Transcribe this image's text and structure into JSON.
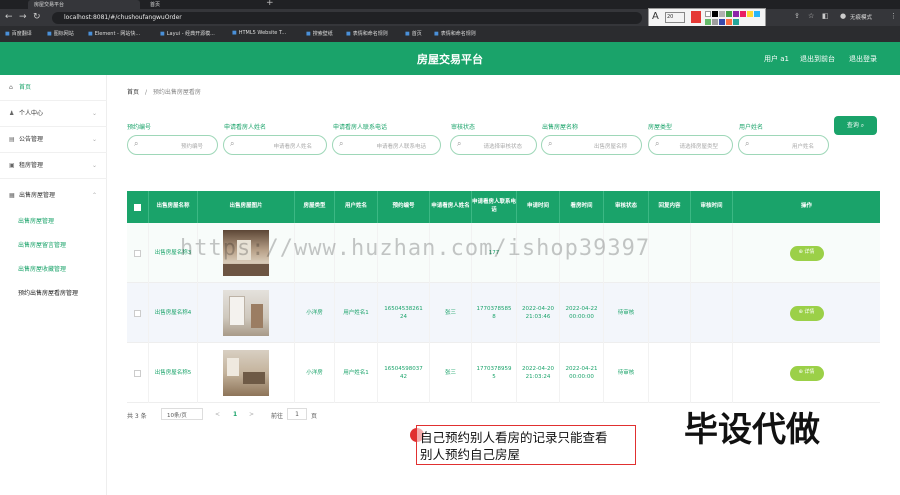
{
  "browser": {
    "tabs": [
      "房屋交易平台",
      "首页"
    ],
    "url": "localhost:8081/#/chushoufangwuOrder",
    "bookmarks": [
      "百度翻译",
      "图标网站",
      "Element - 网站快...",
      "Layui - 经典开源模...",
      "HTML5 Website T...",
      "搜索壁纸",
      "表情和命名规则",
      "首页",
      "表情和命名规则"
    ],
    "annotation_size": "20",
    "annotation_colors": [
      "#e53935",
      "#ffffff",
      "#000000",
      "#b0b0b0",
      "#43a047",
      "#8e24aa",
      "#e91e63",
      "#fdd835",
      "#29b6f6",
      "#66bb6a",
      "#9e9e9e",
      "#3949ab",
      "#ff7043",
      "#26a69a"
    ],
    "profile": "无痕模式"
  },
  "header": {
    "title": "房屋交易平台",
    "user": "用户 a1",
    "back_to_admin": "退出到前台",
    "logout": "退出登录"
  },
  "sidebar": {
    "items": [
      {
        "label": "首页",
        "icon": "home-icon"
      },
      {
        "label": "个人中心",
        "icon": "user-icon"
      },
      {
        "label": "公告管理",
        "icon": "notice-icon"
      },
      {
        "label": "租房管理",
        "icon": "rent-icon"
      },
      {
        "label": "出售房屋管理",
        "icon": "sale-icon"
      }
    ],
    "subitems": [
      "出售房屋管理",
      "出售房屋留言管理",
      "出售房屋收藏管理",
      "预约出售房屋看房管理"
    ]
  },
  "breadcrumb": {
    "home": "首页",
    "sep": "/",
    "current": "预约出售房屋看房"
  },
  "filters": [
    {
      "label": "预约编号",
      "placeholder": "预约编号"
    },
    {
      "label": "申请看房人姓名",
      "placeholder": "申请看房人姓名"
    },
    {
      "label": "申请看房人联系电话",
      "placeholder": "申请看房人联系电话"
    },
    {
      "label": "审核状态",
      "placeholder": "请选择审核状态"
    },
    {
      "label": "出售房屋名称",
      "placeholder": "出售房屋名称"
    },
    {
      "label": "房屋类型",
      "placeholder": "请选择房屋类型"
    },
    {
      "label": "用户姓名",
      "placeholder": "用户姓名"
    }
  ],
  "search_button": "查询",
  "table": {
    "headers": [
      "出售房屋名称",
      "出售房屋图片",
      "房屋类型",
      "用户姓名",
      "预约编号",
      "申请看房人姓名",
      "申请看房人联系电话",
      "申请时间",
      "看房时间",
      "审核状态",
      "回复内容",
      "审核时间",
      "操作"
    ],
    "rows": [
      {
        "name": "出售房屋名称3",
        "type": "",
        "user": "",
        "order": "",
        "applicant": "",
        "phone": "177",
        "apply_time": "",
        "visit_time": "",
        "status": "",
        "reply": "",
        "audit_time": "",
        "action": "详情"
      },
      {
        "name": "出售房屋名称4",
        "type": "小洋房",
        "user": "用户姓名1",
        "order": "1650453826124",
        "applicant": "张三",
        "phone": "17703785858",
        "apply_time": "2022-04-20 21:03:46",
        "visit_time": "2022-04-22 00:00:00",
        "status": "待审核",
        "reply": "",
        "audit_time": "",
        "action": "详情"
      },
      {
        "name": "出售房屋名称5",
        "type": "小洋房",
        "user": "用户姓名1",
        "order": "1650459803742",
        "applicant": "张三",
        "phone": "17703789595",
        "apply_time": "2022-04-20 21:03:24",
        "visit_time": "2022-04-21 00:00:00",
        "status": "待审核",
        "reply": "",
        "audit_time": "",
        "action": "详情"
      }
    ]
  },
  "pagination": {
    "total": "共 3 条",
    "page_size": "10条/页",
    "prev": "<",
    "page": "1",
    "next": ">",
    "goto": "前往",
    "goto_value": "1",
    "page_unit": "页"
  },
  "watermark": "https://www.huzhan.com/ishop39397",
  "overlay": {
    "big_text": "毕设代做",
    "note_line1": "自己预约别人看房的记录只能查看",
    "note_line2": "别人预约自己房屋"
  }
}
